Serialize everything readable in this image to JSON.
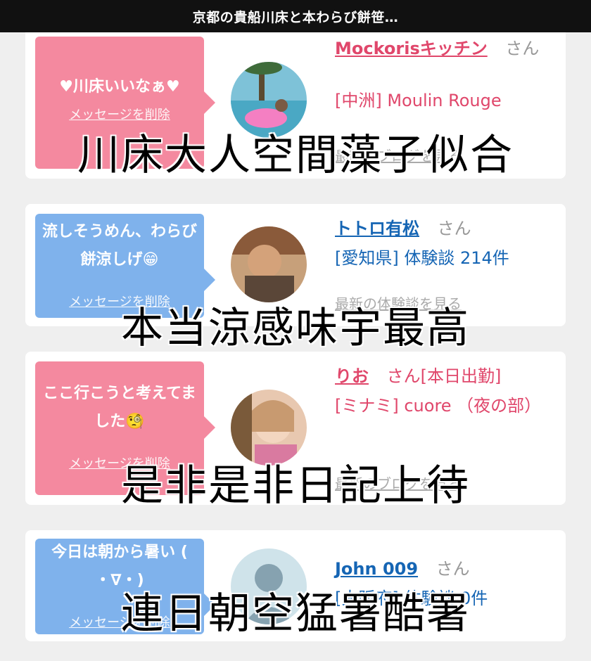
{
  "header": {
    "title": "京都の貴船川床と本わらび餅笹…"
  },
  "cards": [
    {
      "message": "♥川床いいなぁ♥",
      "delete_label": "メッセージを削除",
      "username": "Mockorisキッチン",
      "honorific": "さん",
      "subline": "[中洲] Moulin Rouge",
      "more_label": "最新のブログを見る"
    },
    {
      "message": "流しそうめん、わらび餅涼しげ😁",
      "delete_label": "メッセージを削除",
      "username": "トトロ有松",
      "honorific": "さん",
      "subline": "[愛知県] 体験談 214件",
      "more_label": "最新の体験談を見る"
    },
    {
      "message": "ここ行こうと考えてました🧐",
      "delete_label": "メッセージを削除",
      "username": "りお",
      "honorific": "さん[本日出勤]",
      "subline": "[ミナミ] cuore （夜の部）",
      "more_label": "最新のブログを見る"
    },
    {
      "message": "今日は朝から暑い ( ・∇・)",
      "delete_label": "メッセージを削除",
      "username": "John 009",
      "honorific": "さん",
      "subline": "[大阪府] 体験談 0件"
    }
  ],
  "captions": [
    "川床大人空間藻子似合",
    "本当涼感味宇最高",
    "是非是非日記上待",
    "連日朝空猛署酷署"
  ],
  "colors": {
    "pink": "#f4899f",
    "blue": "#7fb2ec",
    "pink_text": "#e0476b",
    "blue_text": "#1565b4"
  }
}
